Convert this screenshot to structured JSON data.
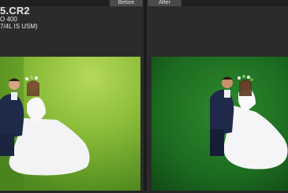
{
  "toolbar": {
    "before_label": "Before",
    "after_label": "After"
  },
  "file_info": {
    "filename": "5.CR2",
    "iso": "O 400",
    "lens": "7/4L IS USM)"
  },
  "colors": {
    "before_grass": "#8fbf3c",
    "after_grass": "#1f6e23",
    "panel_bg": "#2b2b2b"
  },
  "photos": {
    "before": {
      "label": "wedding-photo-before"
    },
    "after": {
      "label": "wedding-photo-after"
    }
  }
}
